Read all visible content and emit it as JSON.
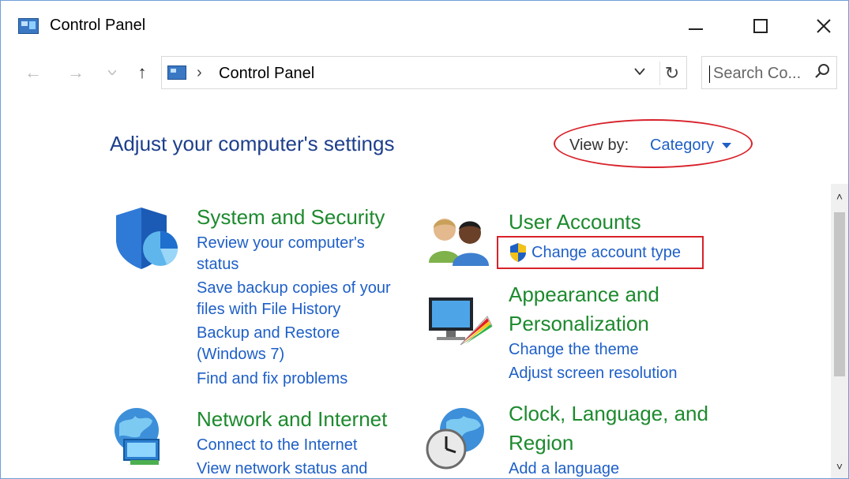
{
  "window": {
    "title": "Control Panel",
    "min_label": "",
    "close_label": "✕"
  },
  "navigation": {
    "back": "←",
    "forward": "→",
    "recent": "⌄",
    "up": "↑",
    "address_separator": "›",
    "address_path": "Control Panel",
    "address_dropdown": "⌄",
    "refresh": "↻",
    "search_placeholder": "Search Co...",
    "search_icon": "⌕"
  },
  "content": {
    "heading": "Adjust your computer's settings",
    "view_by_label": "View by:",
    "view_by_value": "Category"
  },
  "categories": {
    "system_security": {
      "title": "System and Security",
      "links": [
        "Review your computer's",
        "status",
        "Save backup copies of your",
        "files with File History",
        "Backup and Restore",
        "(Windows 7)",
        "Find and fix problems"
      ]
    },
    "network": {
      "title": "Network and Internet",
      "links": [
        "Connect to the Internet",
        "View network status and"
      ]
    },
    "user_accounts": {
      "title": "User Accounts",
      "links": [
        "Change account type"
      ]
    },
    "appearance": {
      "title_line1": "Appearance and",
      "title_line2": "Personalization",
      "links": [
        "Change the theme",
        "Adjust screen resolution"
      ]
    },
    "clock": {
      "title_line1": "Clock, Language, and",
      "title_line2": "Region",
      "links": [
        "Add a language"
      ]
    }
  },
  "scrollbar": {
    "up": "˄",
    "down": "˅"
  },
  "colors": {
    "category_green": "#1d8a2e",
    "link_blue": "#1e5fc7",
    "heading_blue": "#1e3f8c",
    "highlight_red": "#d8222a"
  },
  "icons": {
    "app": "control-panel-icon",
    "system_security": "shield-pie-icon",
    "user_accounts": "users-icon",
    "uac": "uac-shield-icon",
    "appearance": "monitor-palette-icon",
    "network": "globe-network-icon",
    "clock": "globe-clock-icon"
  }
}
